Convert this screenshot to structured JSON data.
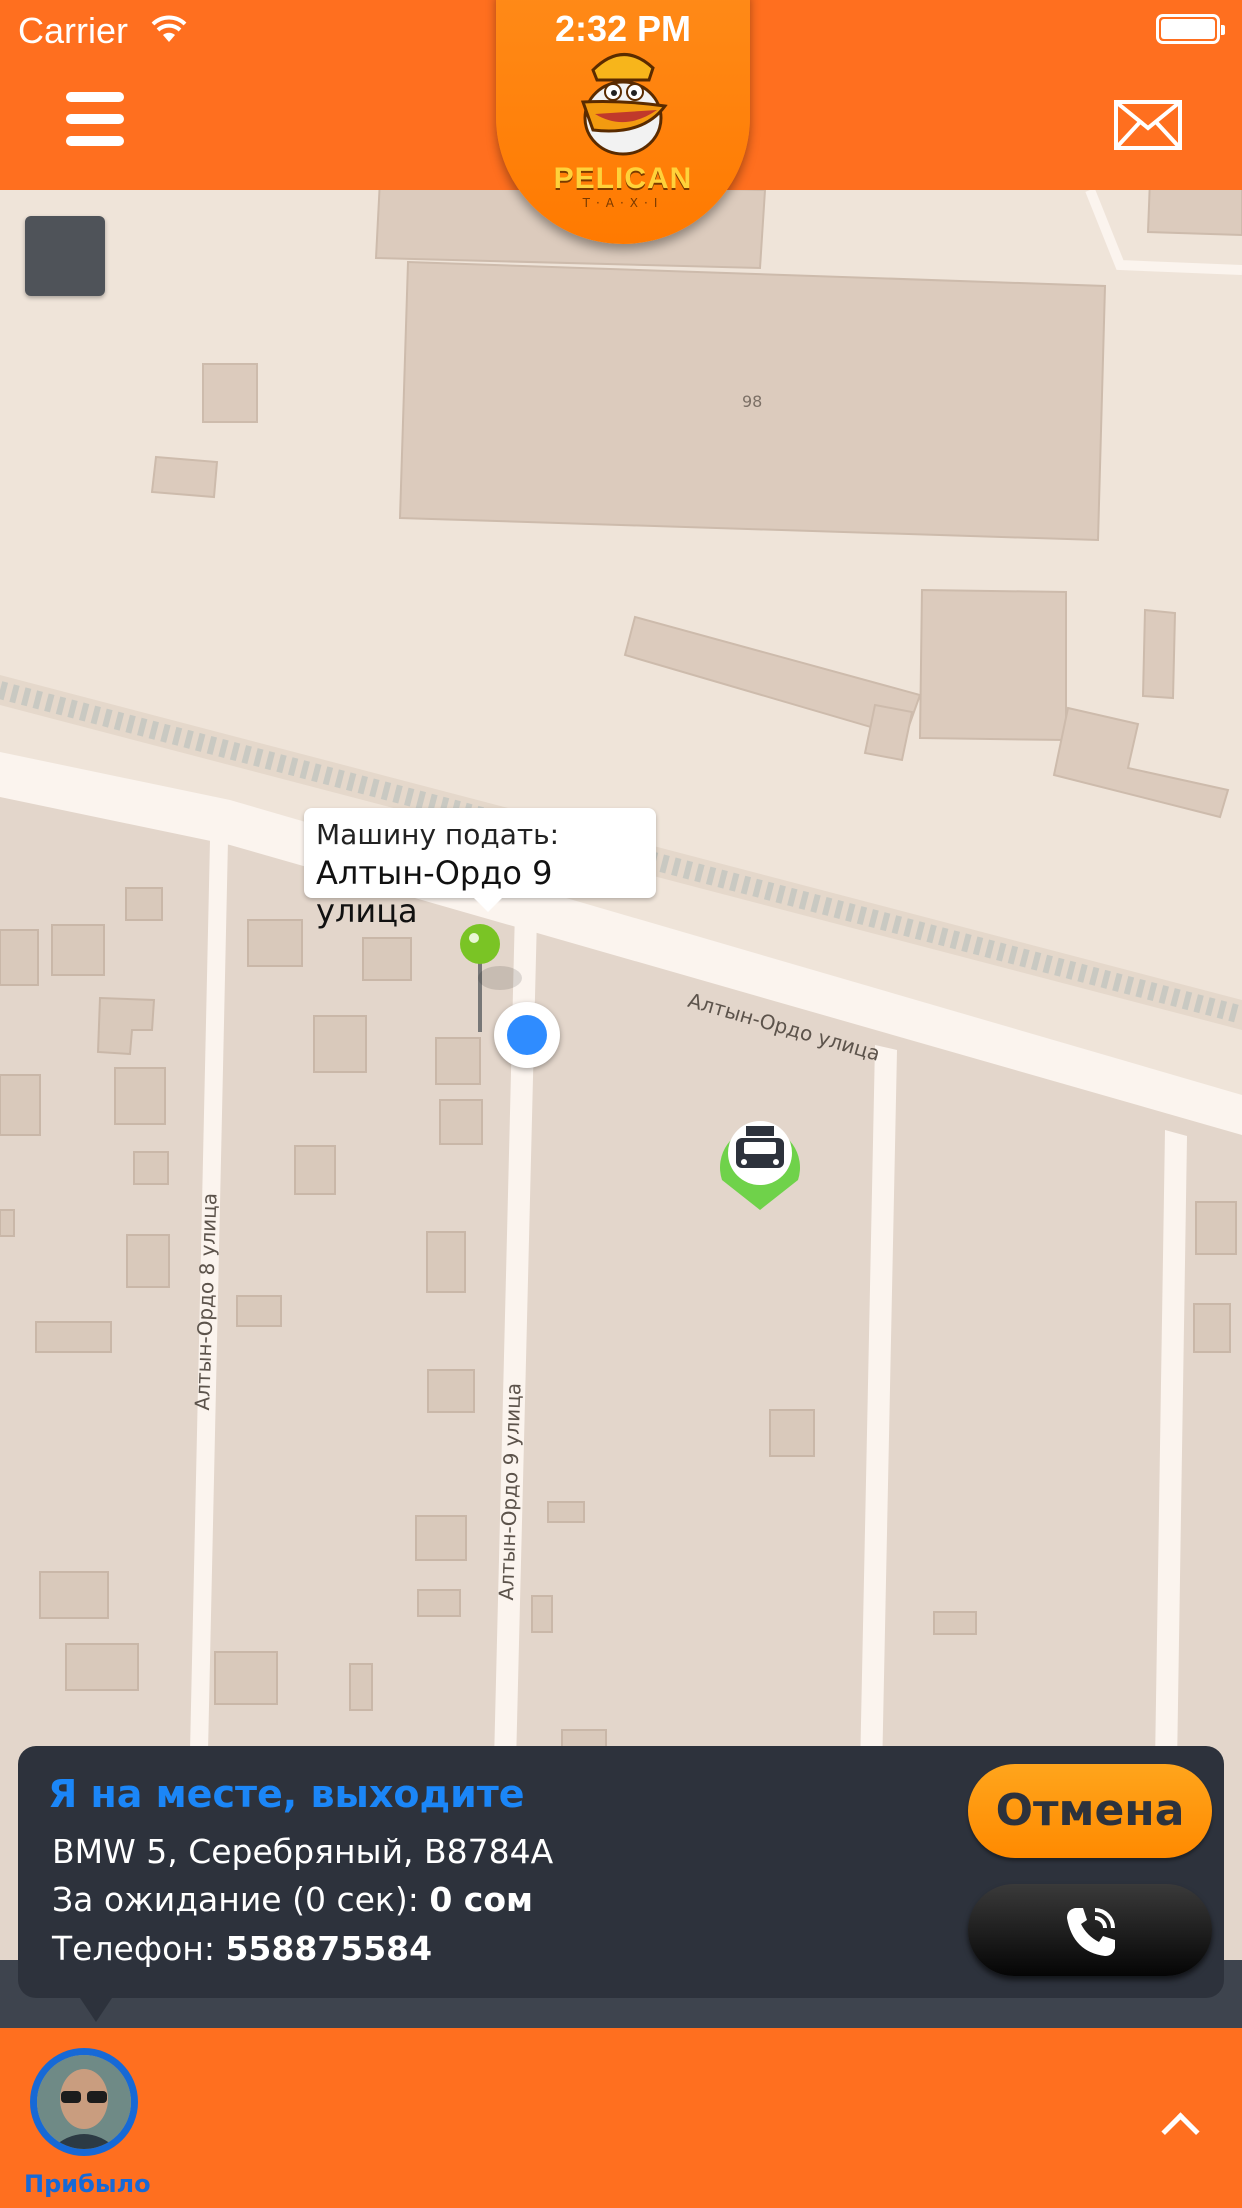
{
  "status_bar": {
    "carrier": "Carrier",
    "time": "2:32 PM"
  },
  "header": {
    "brand": "PELICAN",
    "brand_sub": "T·A·X·I"
  },
  "map": {
    "pickup_callout": {
      "title": "Машину подать:",
      "address": "Алтын-Ордо 9 улица"
    },
    "street_labels": {
      "main_street": "Алтын-Ордо улица",
      "street_8": "Алтын-Ордо 8 улица",
      "street_9": "Алтын-Ордо 9 улица"
    },
    "building_number": "98",
    "taxi_marker_label": "TAXI"
  },
  "ride_panel": {
    "status_title": "Я на месте, выходите",
    "car_info": "BMW 5, Серебряный, B8784A",
    "wait_label": "За ожидание (0 сек): ",
    "wait_value": "0 сом",
    "phone_label": "Телефон: ",
    "phone_value": "558875584",
    "cancel_label": "Отмена"
  },
  "bottom_bar": {
    "driver_status": "Прибыло"
  },
  "colors": {
    "accent_orange": "#ff6f1f",
    "panel_dark": "#2d323c",
    "status_blue": "#1b86f7",
    "pin_green": "#7ac425"
  },
  "icons": [
    "menu-icon",
    "mail-icon",
    "wifi-icon",
    "battery-icon",
    "locate-icon",
    "pin-icon",
    "taxi-marker-icon",
    "phone-icon",
    "chevron-up-icon"
  ]
}
